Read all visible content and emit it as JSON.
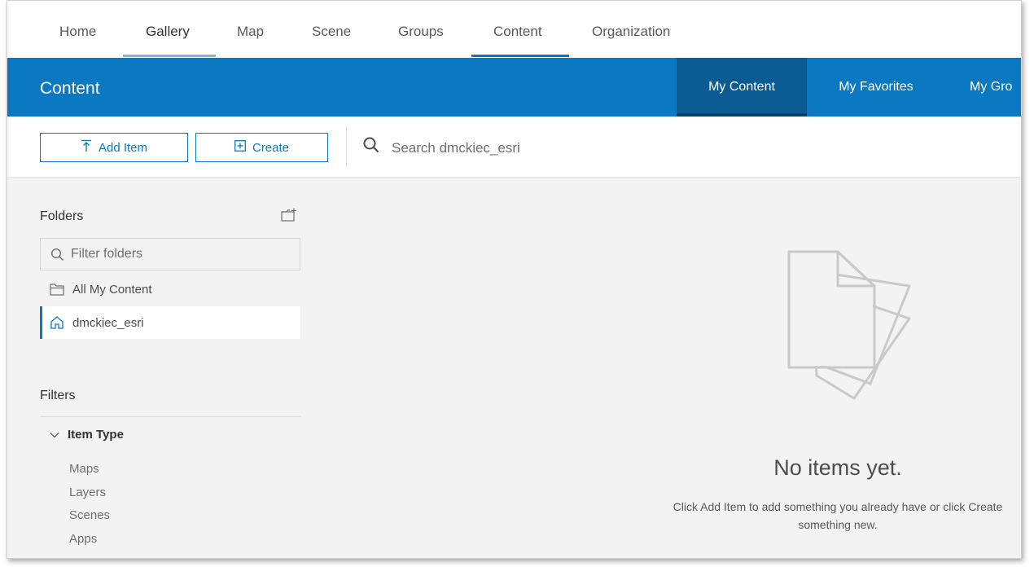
{
  "topnav": {
    "items": [
      "Home",
      "Gallery",
      "Map",
      "Scene",
      "Groups",
      "Content",
      "Organization"
    ]
  },
  "header": {
    "title": "Content",
    "tabs": [
      "My Content",
      "My Favorites",
      "My Gro"
    ],
    "active_tab": "My Content"
  },
  "toolbar": {
    "add_item_label": "Add Item",
    "create_label": "Create",
    "search_placeholder": "Search dmckiec_esri"
  },
  "sidebar": {
    "folders_heading": "Folders",
    "filter_placeholder": "Filter folders",
    "folders": [
      "All My Content",
      "dmckiec_esri"
    ],
    "filters_heading": "Filters",
    "item_type_heading": "Item Type",
    "item_types": [
      "Maps",
      "Layers",
      "Scenes",
      "Apps"
    ]
  },
  "empty_state": {
    "title": "No items yet.",
    "description_line1": "Click Add Item to add something you already have or click Create",
    "description_line2": "something new."
  },
  "colors": {
    "brand_blue": "#0b79c1",
    "active_tab": "#0a5b91",
    "gallery_underline": "#84b5dd",
    "content_underline": "#0b79c1"
  }
}
